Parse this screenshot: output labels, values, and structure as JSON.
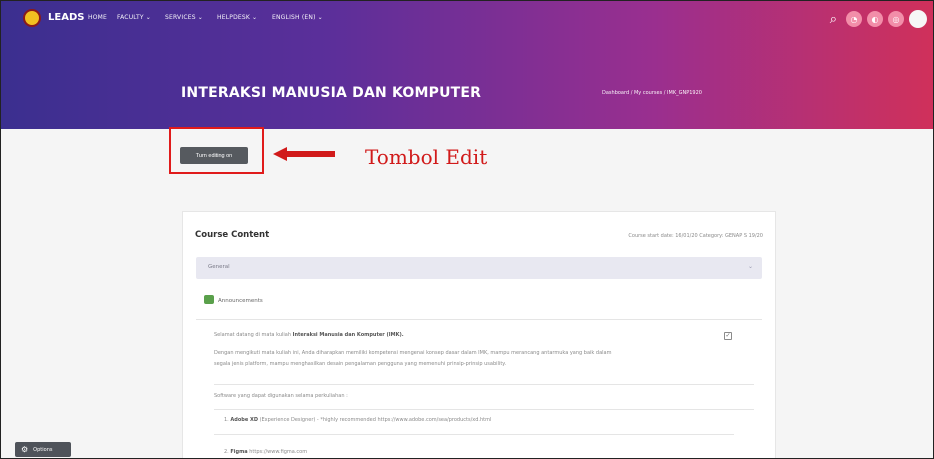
{
  "navbar": {
    "brand": "LEADS",
    "items": [
      {
        "label": "HOME",
        "caret": false
      },
      {
        "label": "FACULTY",
        "caret": true
      },
      {
        "label": "SERVICES",
        "caret": true
      },
      {
        "label": "HELPDESK",
        "caret": true
      },
      {
        "label": "ENGLISH (EN)",
        "caret": true
      }
    ],
    "caret_glyph": "⌄",
    "icons": [
      "search-icon",
      "notification-icon",
      "message-icon",
      "settings-icon",
      "avatar"
    ]
  },
  "header": {
    "title": "INTERAKSI MANUSIA DAN KOMPUTER",
    "breadcrumb": "Dashboard / My courses / IMK_GNP1920"
  },
  "editing": {
    "button_label": "Turn editing on",
    "annotation": "Tombol Edit"
  },
  "course": {
    "title": "Course Content",
    "meta": "Course start date: 16/01/20  Category: GENAP S 19/20",
    "section_label": "General",
    "announcements_label": "Announcements",
    "lines": [
      {
        "text": "Selamat datang di mata kuliah ",
        "bold": "Interaksi Manusia dan Komputer (IMK)."
      },
      {
        "text": "Dengan mengikuti mata kuliah ini, Anda diharapkan memiliki kompetensi mengenai konsep dasar dalam IMK, mampu merancang antarmuka yang baik dalam",
        "bold": ""
      },
      {
        "text": "segala jenis platform, mampu menghasilkan desain pengalaman pengguna yang memenuhi prinsip-prinsip usability.",
        "bold": ""
      },
      {
        "text": "Software yang dapat digunakan selama perkuliahan :",
        "bold": ""
      },
      {
        "text": "1. ",
        "bold": "Adobe XD",
        "rest": " (Experience Designer) - *highly recommended https://www.adobe.com/sea/products/xd.html"
      },
      {
        "text": "2. ",
        "bold": "Figma",
        "rest": " https://www.figma.com"
      }
    ]
  },
  "options": {
    "label": "Options"
  },
  "colors": {
    "annotation_red": "#d11a1a",
    "gradient_start": "#3b2f8f",
    "gradient_end": "#d0305a"
  }
}
